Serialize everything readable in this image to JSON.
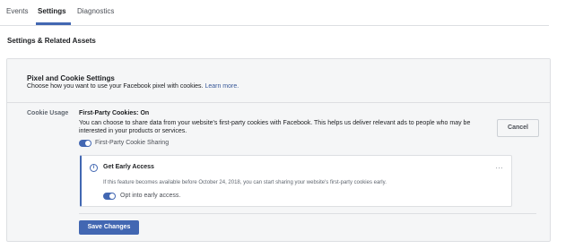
{
  "tabs": [
    {
      "label": "Events"
    },
    {
      "label": "Settings",
      "active": true
    },
    {
      "label": "Diagnostics"
    }
  ],
  "section_title": "Settings & Related Assets",
  "card": {
    "title": "Pixel and Cookie Settings",
    "subtitle": "Choose how you want to use your Facebook pixel with cookies.",
    "learn_more": "Learn more."
  },
  "cookie": {
    "label": "Cookie Usage",
    "title": "First-Party Cookies: On",
    "description": "You can choose to share data from your website's first-party cookies with Facebook. This helps us deliver relevant ads to people who may be interested in your products or services.",
    "cancel_label": "Cancel",
    "toggle_label": "First-Party Cookie Sharing",
    "toggle_on": true
  },
  "early_access": {
    "title": "Get Early Access",
    "description": "If this feature becomes available before October 24, 2018, you can start sharing your website's first-party cookies early.",
    "more_icon": "…",
    "info_icon": "i",
    "toggle_label": "Opt into early access.",
    "toggle_on": true
  },
  "save_label": "Save Changes",
  "colors": {
    "accent": "#4267b2",
    "link": "#385898",
    "panel_bg": "#f5f6f7",
    "border": "#dddfe2"
  }
}
